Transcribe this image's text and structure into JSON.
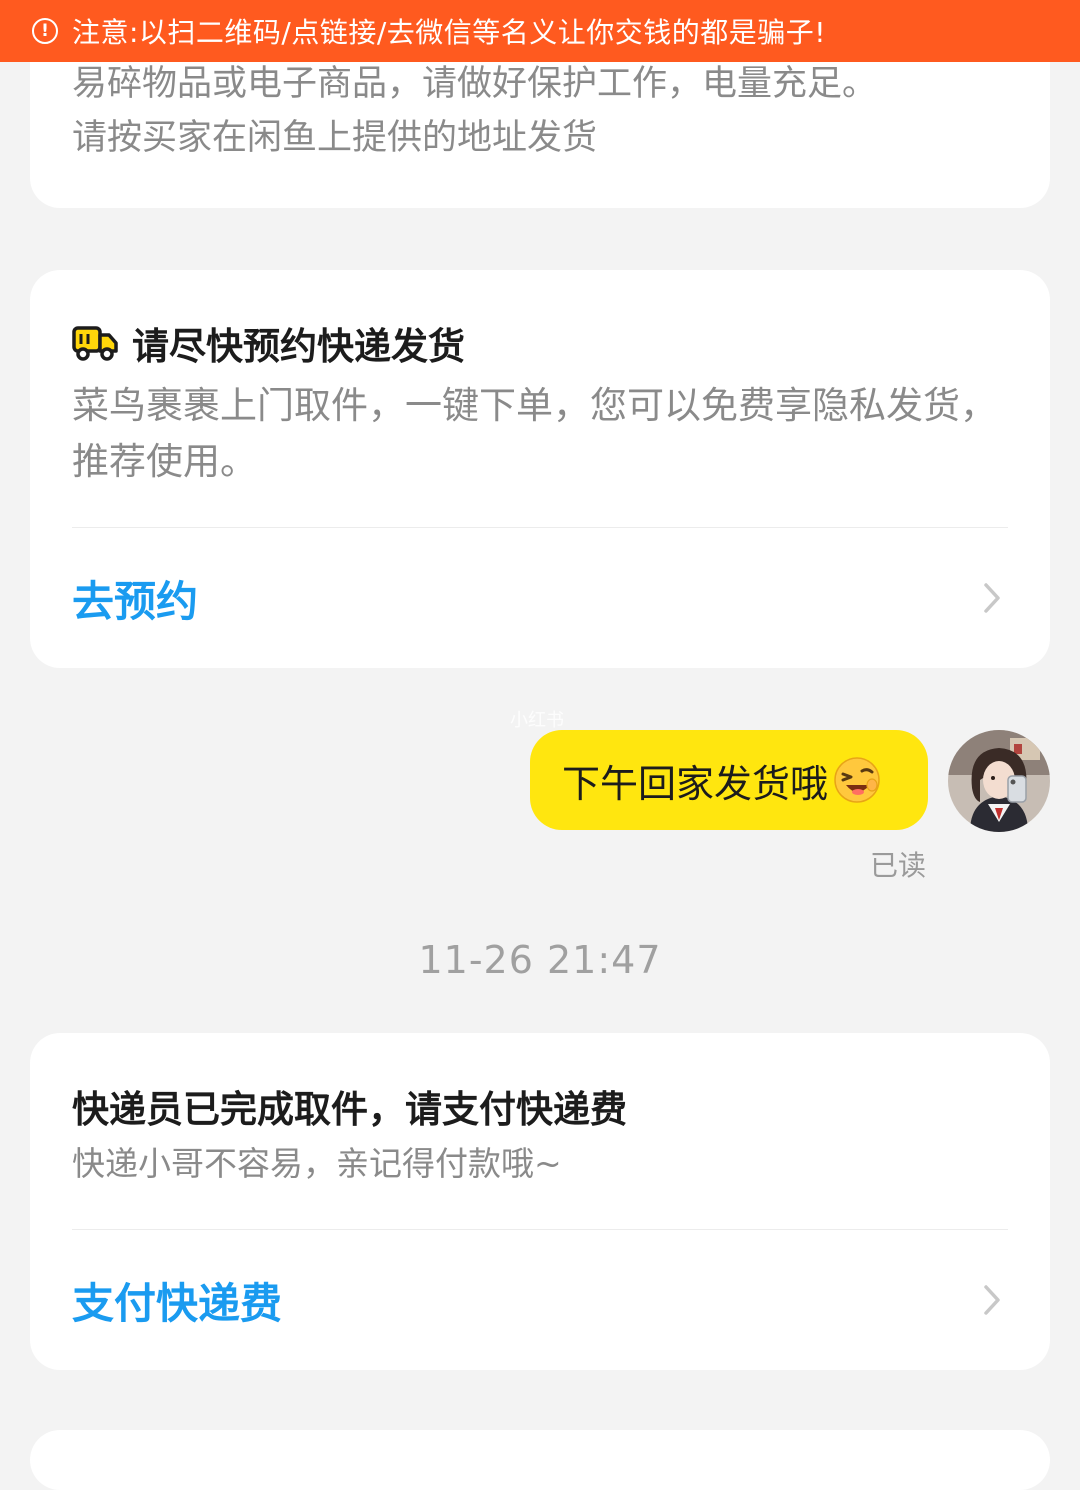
{
  "warning": {
    "icon": "exclamation-circle-icon",
    "text": "注意:以扫二维码/点链接/去微信等名义让你交钱的都是骗子!"
  },
  "shipping_note": {
    "partial_line": "易碎物品或电子商品，请做好保护工作，电量充足。",
    "address_line": "请按买家在闲鱼上提供的地址发货"
  },
  "pickup_card": {
    "icon": "truck-icon",
    "title": "请尽快预约快递发货",
    "description": "菜鸟裹裹上门取件，一键下单，您可以免费享隐私发货，推荐使用。",
    "action_label": "去预约"
  },
  "message": {
    "text": "下午回家发货哦",
    "emoji": "laughing-emoji-icon",
    "status": "已读"
  },
  "watermark": "小红书",
  "timestamp": "11-26 21:47",
  "fee_card": {
    "title": "快递员已完成取件，请支付快递费",
    "description": "快递小哥不容易，亲记得付款哦~",
    "action_label": "支付快递费"
  },
  "colors": {
    "banner": "#ff5a1f",
    "bubble": "#ffe60f",
    "link": "#1a9bf0",
    "background": "#f3f3f3"
  }
}
